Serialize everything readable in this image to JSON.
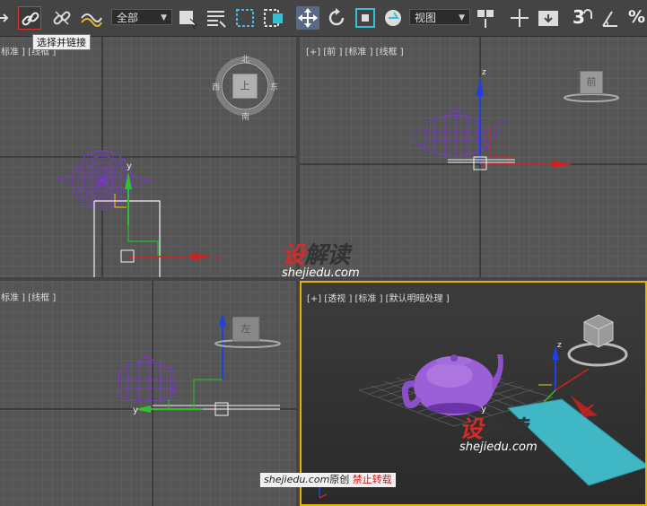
{
  "toolbar": {
    "selection_filter": "全部",
    "ref_coord_system": "视图",
    "percent_snap_label": "%",
    "snap_label": "3"
  },
  "tooltip": "选择并链接",
  "viewports": {
    "top": "标准 ] [线框 ]",
    "front": "[+] [前 ] [标准 ] [线框 ]",
    "left": "标准 ] [线框 ]",
    "perspective": "[+] [透视 ] [标准 ] [默认明暗处理 ]"
  },
  "viewcube": {
    "top_face": "上",
    "front_face": "前",
    "left_face": "左",
    "compass_n": "北",
    "compass_s": "南",
    "compass_w": "西",
    "compass_e": "东"
  },
  "axes": {
    "x": "x",
    "y": "y",
    "z": "z"
  },
  "watermark": {
    "logo_first": "设",
    "logo_rest": "解读",
    "site": "shejiedu.com",
    "credit_site": "shejiedu.com",
    "credit_original": "原创",
    "credit_notice": "禁止转载"
  },
  "colors": {
    "accent_active": "#d23a3a",
    "axis_x": "#d22020",
    "axis_y": "#2fbf2f",
    "axis_z": "#2240e0",
    "wireframe": "#7a36c9",
    "viewport_border_active": "#e8b200",
    "plane": "#3fb7c4"
  }
}
